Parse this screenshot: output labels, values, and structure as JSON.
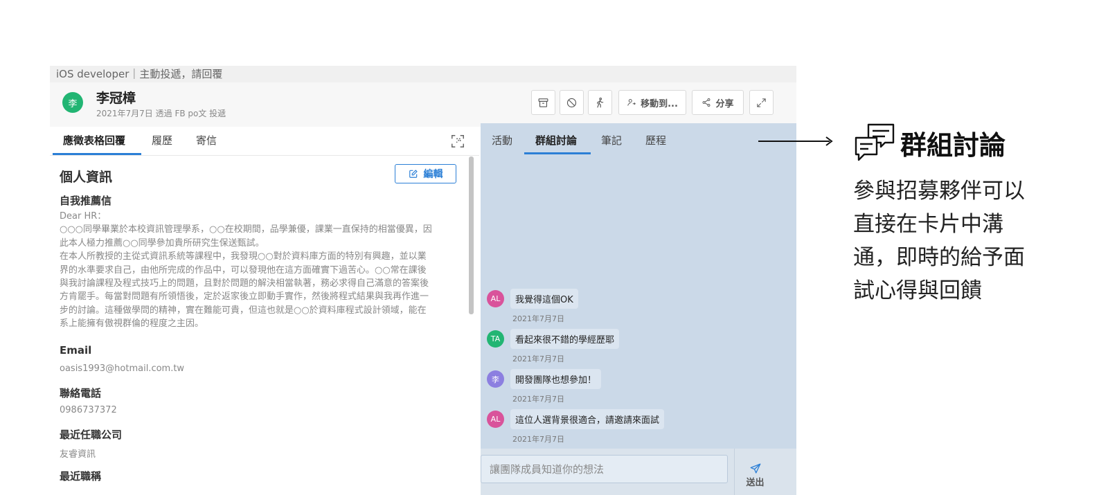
{
  "window": {
    "title": "iOS developer｜主動投遞，請回覆"
  },
  "candidate": {
    "avatar_char": "李",
    "name": "李冠樟",
    "submitted": "2021年7月7日 透過 FB po文 投遞"
  },
  "toolbar": {
    "archive_icon": "archive-icon",
    "block_icon": "block-icon",
    "walk_icon": "walk-icon",
    "move_label": "移動到...",
    "share_label": "分享",
    "expand_icon": "expand-icon"
  },
  "left_tabs": [
    "應徵表格回覆",
    "履歷",
    "寄信"
  ],
  "profile": {
    "section_title": "個人資訊",
    "edit_label": "編輯",
    "recommendation_label": "自我推薦信",
    "recommendation_lines": [
      "Dear HR：",
      "○○○同學畢業於本校資訊管理學系，○○在校期間，品學兼優，課業一直保持的相當優異，因",
      "此本人極力推薦○○同學參加貴所研究生保送甄試。",
      "在本人所教授的主從式資訊系統等課程中，我發現○○對於資料庫方面的特別有興趣，並以業",
      "界的水準要求自己，由他所完成的作品中，可以發現他在這方面確實下過苦心。○○常在課後",
      "與我討論課程及程式技巧上的問題，且對於問題的解決相當執著，務必求得自己滿意的答案後",
      "方肯罷手。每當對問題有所領悟後，定於返家後立即動手實作，然後將程式結果與我再作進一",
      "步的討論。這種做學問的精神，實在難能可貴，但這也就是○○於資料庫程式設計領域，能在",
      "系上能擁有傲視群倫的程度之主因。"
    ],
    "email_label": "Email",
    "email_value": "oasis1993@hotmail.com.tw",
    "phone_label": "聯絡電話",
    "phone_value": "0986737372",
    "company_label": "最近任職公司",
    "company_value": "友睿資訊",
    "title_label": "最近職稱"
  },
  "right_tabs": [
    "活動",
    "群組討論",
    "筆記",
    "歷程"
  ],
  "messages": [
    {
      "avatar": "AL",
      "color": "#d9539b",
      "text": "我覺得這個OK",
      "date": "2021年7月7日"
    },
    {
      "avatar": "TA",
      "color": "#22b573",
      "text": "看起來很不錯的學經歷耶",
      "date": "2021年7月7日"
    },
    {
      "avatar": "李",
      "color": "#8c7fe0",
      "text": "開發團隊也想參加！",
      "date": "2021年7月7日"
    },
    {
      "avatar": "AL",
      "color": "#d9539b",
      "text": "這位人選背景很適合，請邀請來面試",
      "date": "2021年7月7日"
    }
  ],
  "compose": {
    "placeholder": "讓團隊成員知道你的想法",
    "send_label": "送出"
  },
  "annotation": {
    "icon": "chat-bubbles-icon",
    "title": "群組討論",
    "body_lines": [
      "參與招募夥伴可以",
      "直接在卡片中溝",
      "通，即時的給予面",
      "試心得與回饋"
    ]
  }
}
